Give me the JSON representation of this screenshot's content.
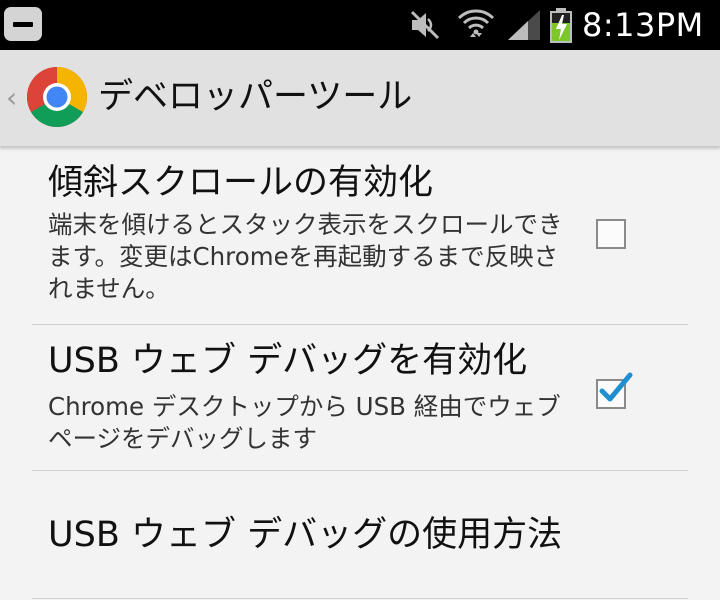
{
  "status_bar": {
    "time": "8:13PM",
    "icons": [
      "notification-icon",
      "mute-icon",
      "wifi-icon",
      "signal-icon",
      "battery-charging-icon"
    ]
  },
  "action_bar": {
    "title": "デベロッパーツール",
    "up_glyph": "‹",
    "logo": "chrome-logo"
  },
  "preferences": [
    {
      "title": "傾斜スクロールの有効化",
      "summary": "端末を傾けるとスタック表示をスクロールできます。変更はChromeを再起動するまで反映されません。",
      "checked": false
    },
    {
      "title": "USB ウェブ デバッグを有効化",
      "summary": "Chrome デスクトップから USB 経由でウェブページをデバッグします",
      "checked": true
    },
    {
      "title": "USB ウェブ デバッグの使用方法"
    }
  ],
  "colors": {
    "accent_check": "#1f8fd1",
    "background": "#f3f3f3",
    "action_bar": "#e1e1e1"
  }
}
